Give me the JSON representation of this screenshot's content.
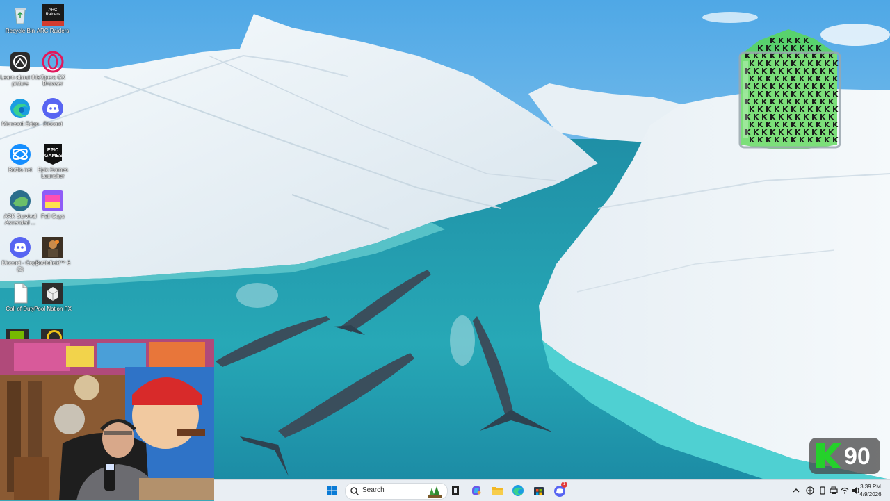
{
  "desktop": {
    "icons": [
      {
        "label": "Recycle Bin",
        "icon": "recycle-bin-icon"
      },
      {
        "label": "ARC Raiders",
        "icon": "arc-raiders-icon"
      },
      {
        "label": "Learn about this picture",
        "icon": "camera-icon"
      },
      {
        "label": "Opera GX Browser",
        "icon": "opera-gx-icon"
      },
      {
        "label": "Microsoft Edge",
        "icon": "edge-icon"
      },
      {
        "label": "Discord",
        "icon": "discord-icon"
      },
      {
        "label": "Battle.net",
        "icon": "battlenet-icon"
      },
      {
        "label": "Epic Games Launcher",
        "icon": "epic-games-icon"
      },
      {
        "label": "ARK Survival Ascended ...",
        "icon": "ark-icon"
      },
      {
        "label": "Fall Guys",
        "icon": "fall-guys-icon"
      },
      {
        "label": "Discord - Copy (2)",
        "icon": "discord-icon"
      },
      {
        "label": "Battlefield™ 6",
        "icon": "battlefield-icon"
      },
      {
        "label": "Call of Duty",
        "icon": "file-icon"
      },
      {
        "label": "Pool Nation FX",
        "icon": "pool-nation-icon"
      }
    ],
    "epic_logo_text": "EPIC GAMES",
    "arc_logo_text": "ARC Raiders"
  },
  "overlay": {
    "kill_count": "90",
    "accent_green": "#25d12b"
  },
  "taskbar": {
    "search_placeholder": "Search",
    "clock_time": "3:39 PM",
    "clock_date": "4/9/2026",
    "discord_badge": "1",
    "pinned": [
      "start-icon",
      "search-icon",
      "task-view-icon",
      "copilot-icon",
      "file-explorer-icon",
      "edge-icon",
      "store-icon",
      "discord-icon"
    ],
    "tray": [
      "chevron-up-icon",
      "network-icon",
      "phone-icon",
      "printer-icon",
      "wifi-icon",
      "volume-icon"
    ]
  },
  "colors": {
    "water": "#2aa8b6",
    "ice": "#eef4f8",
    "taskbar_bg": "#e9eef3"
  }
}
